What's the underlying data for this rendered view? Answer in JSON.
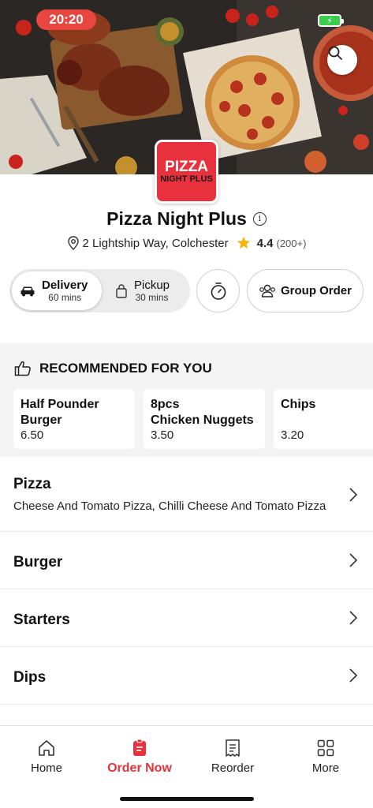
{
  "status_bar": {
    "time": "20:20"
  },
  "restaurant": {
    "logo_line1": "PIZZA",
    "logo_line2": "NIGHT PLUS",
    "name": "Pizza Night Plus",
    "address": "2 Lightship Way, Colchester",
    "rating": "4.4",
    "rating_count": "(200+)"
  },
  "order_type": {
    "delivery": {
      "label": "Delivery",
      "time": "60 mins"
    },
    "pickup": {
      "label": "Pickup",
      "time": "30 mins"
    },
    "group_order_label": "Group Order"
  },
  "recommended": {
    "heading": "RECOMMENDED FOR YOU",
    "items": [
      {
        "name": "Half Pounder\nBurger",
        "price": "6.50"
      },
      {
        "name": "8pcs\n Chicken Nuggets",
        "price": "3.50"
      },
      {
        "name": "Chips",
        "price": "3.20"
      }
    ]
  },
  "categories": [
    {
      "name": "Pizza",
      "desc": "Cheese And Tomato Pizza, Chilli Cheese And Tomato Pizza"
    },
    {
      "name": "Burger"
    },
    {
      "name": "Starters"
    },
    {
      "name": "Dips"
    }
  ],
  "nav": {
    "home": "Home",
    "order_now": "Order Now",
    "reorder": "Reorder",
    "more": "More"
  },
  "colors": {
    "accent": "#e8313c",
    "star": "#f5b50a"
  }
}
